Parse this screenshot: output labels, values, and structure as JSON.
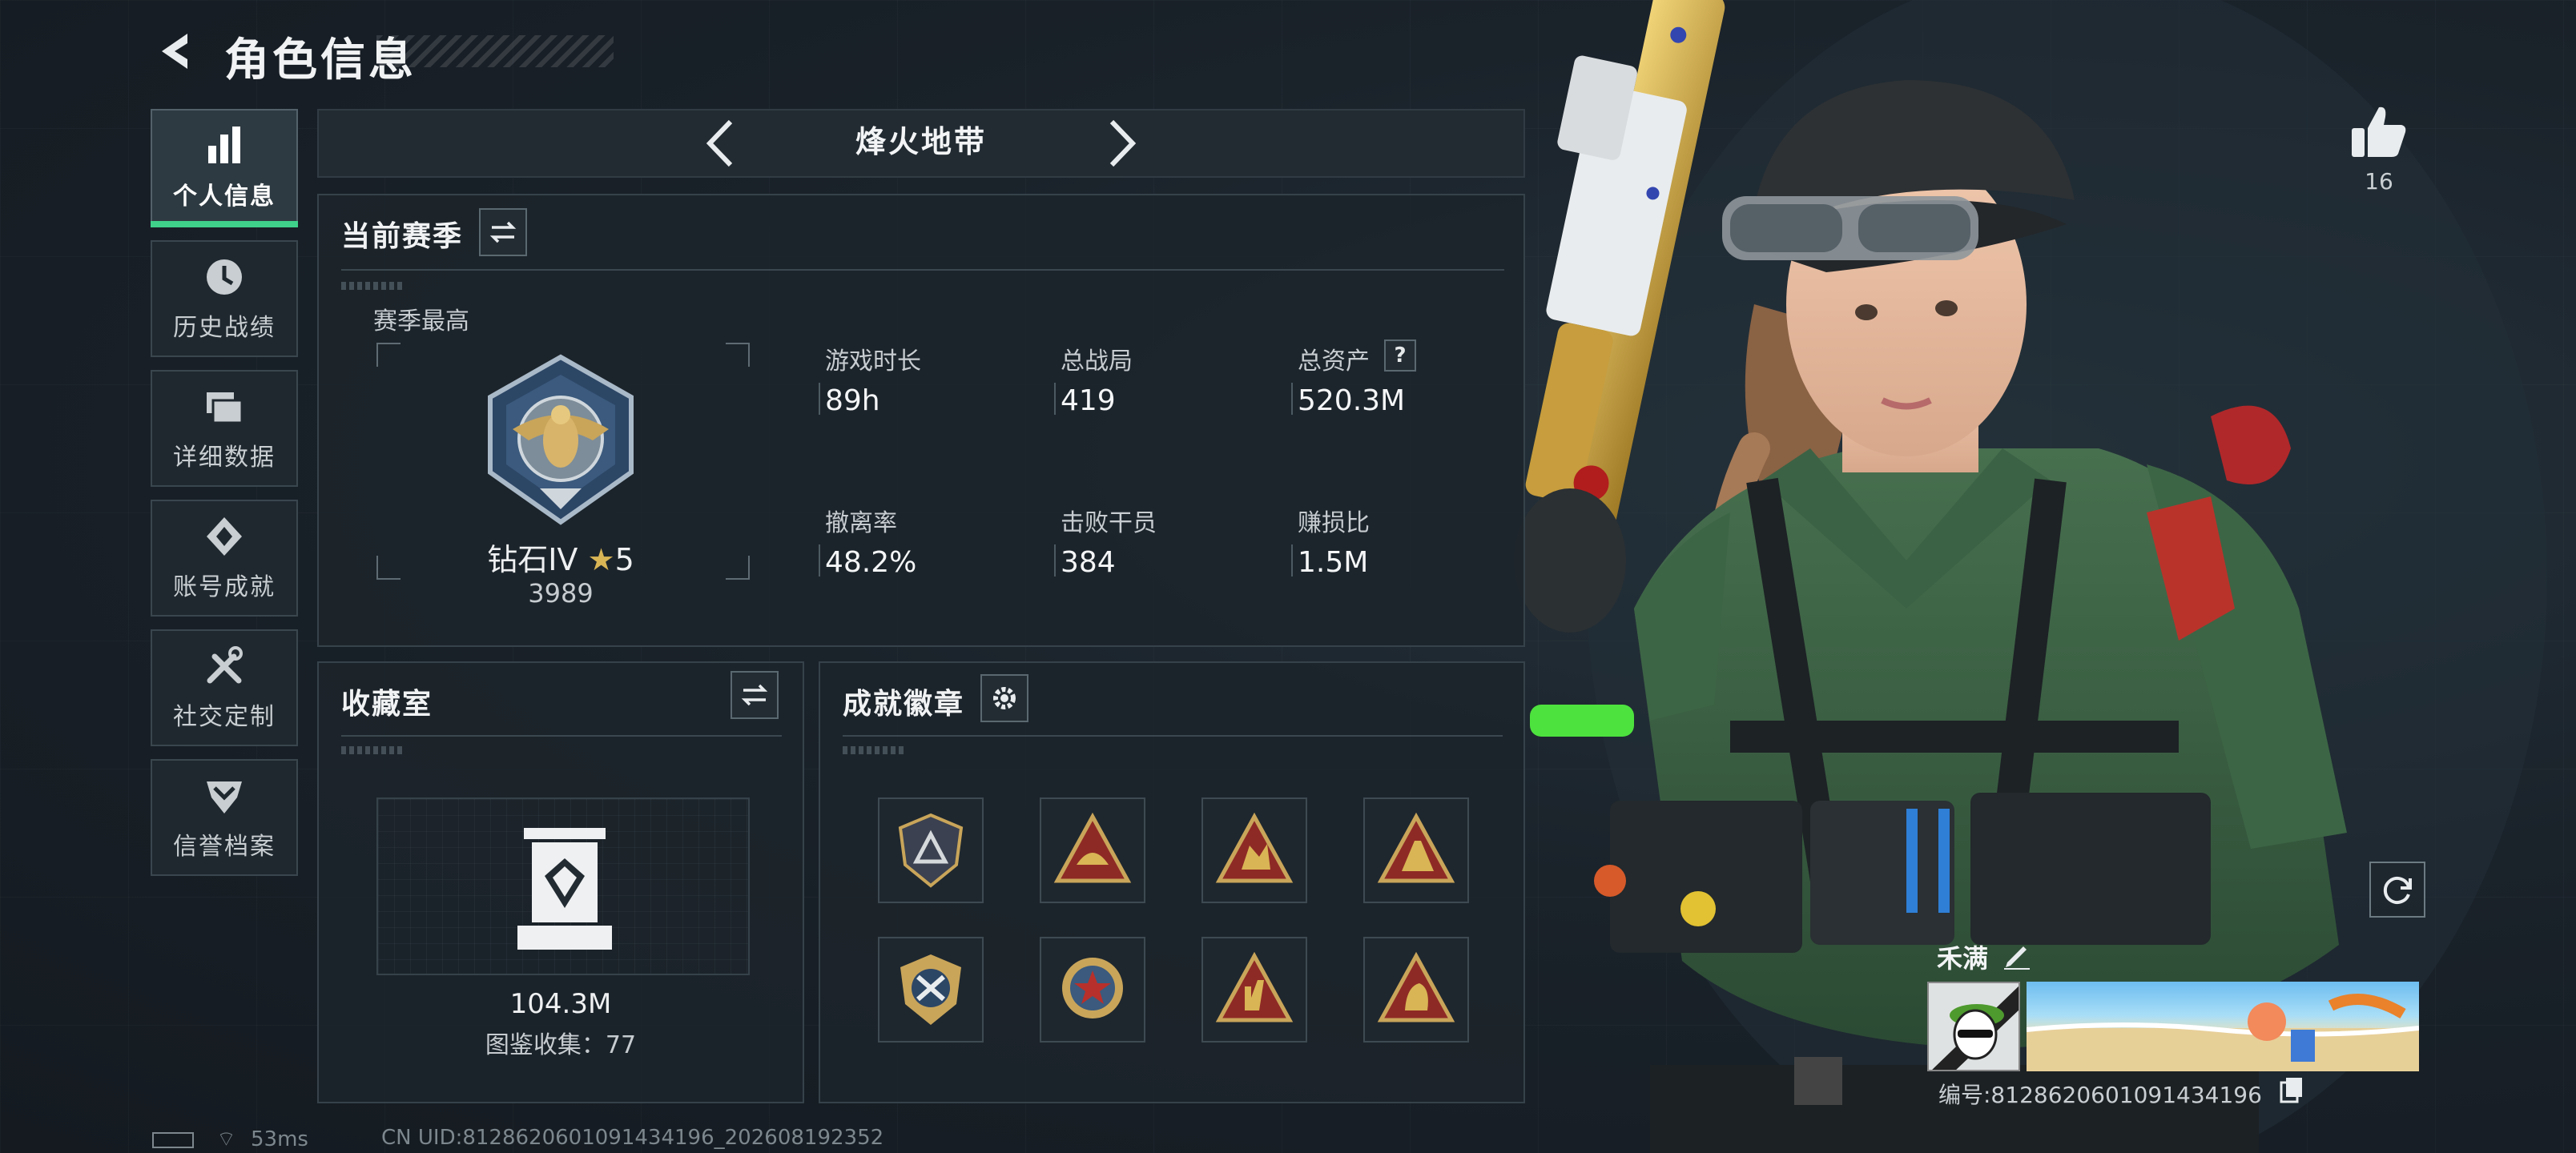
{
  "header": {
    "title": "角色信息"
  },
  "nav": {
    "items": [
      {
        "label": "个人信息",
        "icon": "bar-chart-icon",
        "active": true
      },
      {
        "label": "历史战绩",
        "icon": "history-clock-icon"
      },
      {
        "label": "详细数据",
        "icon": "folders-icon"
      },
      {
        "label": "账号成就",
        "icon": "achievement-diamond-icon"
      },
      {
        "label": "社交定制",
        "icon": "tools-icon"
      },
      {
        "label": "信誉档案",
        "icon": "shield-chevron-icon"
      }
    ]
  },
  "mode": {
    "title": "烽火地带"
  },
  "season": {
    "heading": "当前赛季",
    "best_label": "赛季最高",
    "rank_name": "钻石IV",
    "rank_stars": "5",
    "rank_score": "3989",
    "stats": [
      {
        "label": "游戏时长",
        "value": "89h"
      },
      {
        "label": "总战局",
        "value": "419"
      },
      {
        "label": "总资产",
        "value": "520.3M",
        "has_help": true,
        "help": "?"
      },
      {
        "label": "撤离率",
        "value": "48.2%"
      },
      {
        "label": "击败干员",
        "value": "384"
      },
      {
        "label": "赚损比",
        "value": "1.5M"
      }
    ]
  },
  "collection": {
    "heading": "收藏室",
    "value": "104.3M",
    "catalog_label": "图鉴收集：77"
  },
  "badges": {
    "heading": "成就徽章",
    "items": [
      "badge-1",
      "badge-2",
      "badge-3",
      "badge-4",
      "badge-5",
      "badge-6",
      "badge-7",
      "badge-8"
    ]
  },
  "profile": {
    "likes": "16",
    "name": "禾满",
    "id_text": "编号:8128620601091434196"
  },
  "status": {
    "ping": "53ms",
    "uid": "CN UID:8128620601091434196_202608192352"
  },
  "colors": {
    "accent_green": "#3fd08a",
    "gold": "#c9a55a",
    "badge_red": "#8e2a25"
  }
}
